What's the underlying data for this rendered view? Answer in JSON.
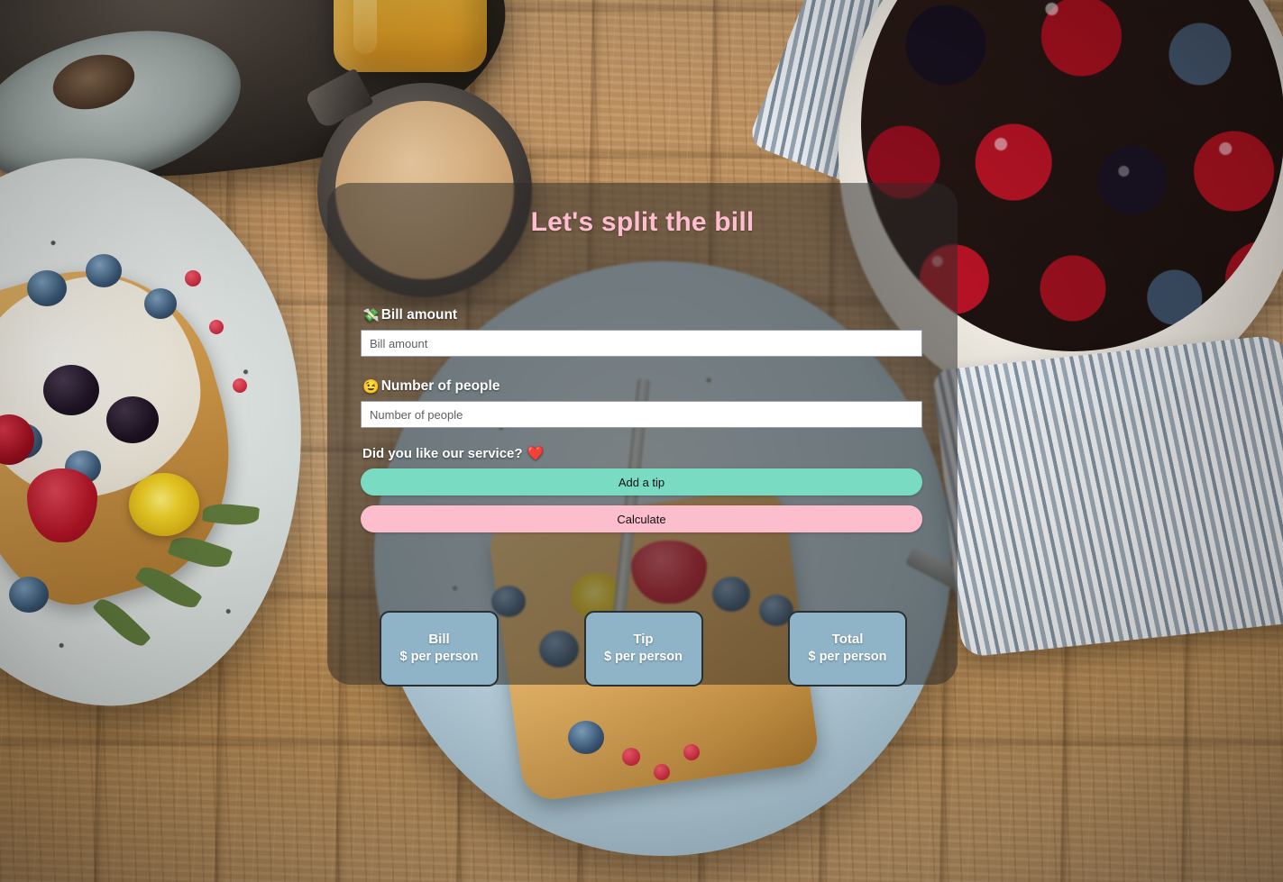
{
  "app": {
    "title": "Let's split the bill",
    "title_color": "#ffbdd0"
  },
  "form": {
    "bill": {
      "icon": "money-with-wings-emoji",
      "icon_glyph": "💸",
      "label": "Bill amount",
      "value": "",
      "placeholder": "Bill amount"
    },
    "people": {
      "icon": "winking-face-emoji",
      "icon_glyph": "😉",
      "label": "Number of people",
      "value": "",
      "placeholder": "Number of people"
    },
    "service": {
      "question": "Did you like our service?",
      "icon": "red-heart-emoji",
      "icon_glyph": "❤️"
    },
    "buttons": {
      "tip": {
        "label": "Add a tip",
        "color": "#79dcc2"
      },
      "calculate": {
        "label": "Calculate",
        "color": "#fcbdcd"
      }
    }
  },
  "results": {
    "card_color": "#8fb4c7",
    "items": [
      {
        "title": "Bill",
        "sub": "$ per person"
      },
      {
        "title": "Tip",
        "sub": "$ per person"
      },
      {
        "title": "Total",
        "sub": "$ per person"
      }
    ]
  }
}
